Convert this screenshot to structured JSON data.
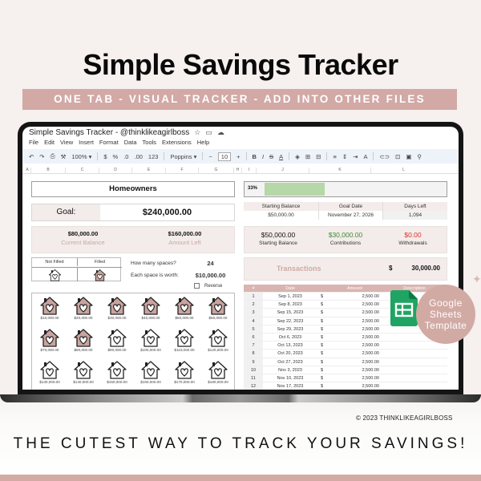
{
  "hero": {
    "title": "Simple Savings Tracker",
    "banner": "ONE TAB - VISUAL TRACKER - ADD INTO OTHER FILES",
    "copyright": "©  2023 THINKLIKEAGIRLBOSS",
    "tagline": "THE CUTEST WAY TO TRACK YOUR SAVINGS!",
    "badge": "Google Sheets Template",
    "badge_lines": [
      "Google",
      "Sheets",
      "Template"
    ]
  },
  "sheet": {
    "doc_title": "Simple Savings Tracker - @thinklikeagirlboss",
    "title_icons": [
      "star-icon",
      "folder-icon",
      "cloud-icon"
    ],
    "menu": [
      "File",
      "Edit",
      "View",
      "Insert",
      "Format",
      "Data",
      "Tools",
      "Extensions",
      "Help"
    ],
    "toolbar": {
      "undo": "↶",
      "redo": "↷",
      "print": "⎙",
      "paint": "🖌",
      "zoom": "100%",
      "currency": "$",
      "percent": "%",
      "dec_less": ".0",
      "dec_more": ".00",
      "format": "123",
      "font": "Poppins",
      "font_size": "10",
      "minus": "−",
      "plus": "+",
      "bold": "B",
      "italic": "I",
      "strike": "S",
      "text_color": "A",
      "fill": "◈",
      "borders": "⊞",
      "merge": "⊟",
      "align": "≡",
      "valign": "⇕",
      "wrap": "⇥",
      "rotate": "A",
      "link": "⊂⊃",
      "comment": "⊡",
      "chart": "▣",
      "filter": "⚲"
    },
    "columns": [
      "A",
      "B",
      "C",
      "D",
      "E",
      "F",
      "G",
      "H",
      "I",
      "J",
      "K",
      "L"
    ]
  },
  "tracker": {
    "category": "Homeowners",
    "goal_label": "Goal:",
    "goal_value": "$240,000.00",
    "current_balance": "$80,000.00",
    "current_balance_label": "Current Balance",
    "amount_left": "$160,000.00",
    "amount_left_label": "Amount Left",
    "legend_not_filled": "Not Filled",
    "legend_filled": "Filled",
    "spaces_label": "How many spaces?",
    "spaces_value": "24",
    "space_worth_label": "Each space is worth:",
    "space_worth_value": "$10,000.00",
    "reverse_label": "Reverse",
    "reverse_checked": false,
    "filled_count": 8,
    "houses": [
      "$10,000.00",
      "$20,000.00",
      "$30,000.00",
      "$40,000.00",
      "$50,000.00",
      "$60,000.00",
      "$70,000.00",
      "$80,000.00",
      "$90,000.00",
      "$100,000.00",
      "$110,000.00",
      "$120,000.00",
      "$130,000.00",
      "$140,000.00",
      "$150,000.00",
      "$160,000.00",
      "$170,000.00",
      "$180,000.00"
    ],
    "colors": {
      "filled": "#c9a49e",
      "accent": "#d2a9a5",
      "progress": "#b6d7a8",
      "positive": "#3d8b37",
      "negative": "#e0302a"
    }
  },
  "progress": {
    "label": "33%",
    "fraction": 0.33
  },
  "info": {
    "headers": [
      "Starting Balance",
      "Goal Date",
      "Days Left"
    ],
    "values": [
      "$50,000.00",
      "November 27, 2026",
      "1,094"
    ]
  },
  "summary": [
    {
      "value": "$50,000.00",
      "label": "Starting Balance"
    },
    {
      "value": "$30,000.00",
      "label": "Contributions"
    },
    {
      "value": "$0.00",
      "label": "Withdrawals"
    }
  ],
  "transactions": {
    "title": "Transactions",
    "currency": "$",
    "total": "30,000.00",
    "headers": [
      "#",
      "Date",
      "Amount",
      "Description"
    ],
    "rows": [
      {
        "n": "1",
        "date": "Sep 1, 2023",
        "cur": "$",
        "amount": "2,500.00"
      },
      {
        "n": "2",
        "date": "Sep 8, 2023",
        "cur": "$",
        "amount": "2,500.00"
      },
      {
        "n": "3",
        "date": "Sep 15, 2023",
        "cur": "$",
        "amount": "2,500.00"
      },
      {
        "n": "4",
        "date": "Sep 22, 2023",
        "cur": "$",
        "amount": "2,500.00"
      },
      {
        "n": "5",
        "date": "Sep 29, 2023",
        "cur": "$",
        "amount": "2,500.00"
      },
      {
        "n": "6",
        "date": "Oct 6, 2023",
        "cur": "$",
        "amount": "2,500.00"
      },
      {
        "n": "7",
        "date": "Oct 13, 2023",
        "cur": "$",
        "amount": "2,500.00"
      },
      {
        "n": "8",
        "date": "Oct 20, 2023",
        "cur": "$",
        "amount": "2,500.00"
      },
      {
        "n": "9",
        "date": "Oct 27, 2023",
        "cur": "$",
        "amount": "2,500.00"
      },
      {
        "n": "10",
        "date": "Nov 3, 2023",
        "cur": "$",
        "amount": "2,500.00"
      },
      {
        "n": "11",
        "date": "Nov 10, 2023",
        "cur": "$",
        "amount": "2,500.00"
      },
      {
        "n": "12",
        "date": "Nov 17, 2023",
        "cur": "$",
        "amount": "2,500.00"
      }
    ]
  }
}
